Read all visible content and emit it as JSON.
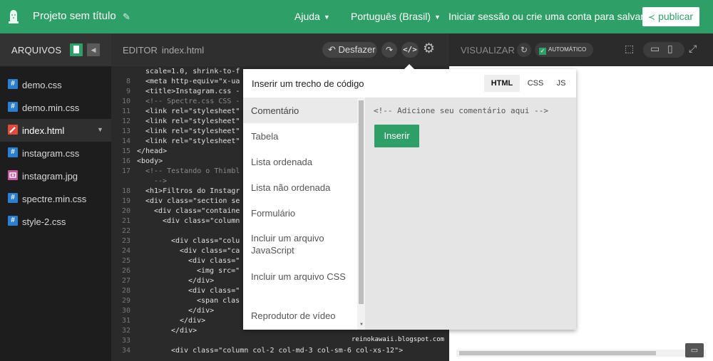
{
  "topbar": {
    "title": "Projeto sem título",
    "help": "Ajuda",
    "language": "Português (Brasil)",
    "login": "Iniciar sessão ou crie uma conta para salvar e",
    "publish": "publicar"
  },
  "sidebar": {
    "header": "ARQUIVOS",
    "files": [
      {
        "name": "demo.css",
        "icon": "#",
        "color": "#2a7fd1"
      },
      {
        "name": "demo.min.css",
        "icon": "#",
        "color": "#2a7fd1"
      },
      {
        "name": "index.html",
        "icon": "",
        "color": "#e04a3d"
      },
      {
        "name": "instagram.css",
        "icon": "#",
        "color": "#2a7fd1"
      },
      {
        "name": "instagram.jpg",
        "icon": "",
        "color": "#c15a9c"
      },
      {
        "name": "spectre.min.css",
        "icon": "#",
        "color": "#2a7fd1"
      },
      {
        "name": "style-2.css",
        "icon": "#",
        "color": "#2a7fd1"
      }
    ]
  },
  "editor": {
    "label": "EDITOR",
    "filename": "index.html",
    "undo": "Desfazer",
    "lines": [
      {
        "n": "",
        "t": "scale=1.0, shrink-to-f"
      },
      {
        "n": "8",
        "t": "<meta http-equiv=\"x-ua"
      },
      {
        "n": "9",
        "t": "<title>Instagram.css -"
      },
      {
        "n": "10",
        "t": "<!-- Spectre.css CSS -"
      },
      {
        "n": "11",
        "t": "<link rel=\"stylesheet\""
      },
      {
        "n": "12",
        "t": "<link rel=\"stylesheet\""
      },
      {
        "n": "13",
        "t": "<link rel=\"stylesheet\""
      },
      {
        "n": "14",
        "t": "<link rel=\"stylesheet\""
      },
      {
        "n": "15",
        "t": "</head>"
      },
      {
        "n": "16",
        "t": "<body>"
      },
      {
        "n": "17",
        "t": "<!-- Testando o Thimbl"
      },
      {
        "n": "",
        "t": "-->"
      },
      {
        "n": "18",
        "t": "<h1>Filtros do Instagr"
      },
      {
        "n": "19",
        "t": "<div class=\"section se"
      },
      {
        "n": "20",
        "t": "<div class=\"containe"
      },
      {
        "n": "21",
        "t": "<div class=\"column"
      },
      {
        "n": "22",
        "t": ""
      },
      {
        "n": "23",
        "t": "<div class=\"colu"
      },
      {
        "n": "24",
        "t": "<div class=\"ca"
      },
      {
        "n": "25",
        "t": "<div class=\""
      },
      {
        "n": "26",
        "t": "<img src=\""
      },
      {
        "n": "27",
        "t": "</div>"
      },
      {
        "n": "28",
        "t": "<div class=\""
      },
      {
        "n": "29",
        "t": "<span clas"
      },
      {
        "n": "30",
        "t": "</div>"
      },
      {
        "n": "31",
        "t": "</div>"
      },
      {
        "n": "32",
        "t": "</div>"
      },
      {
        "n": "33",
        "t": ""
      },
      {
        "n": "34",
        "t": "<div class=\"column col-2 col-md-3 col-sm-6 col-xs-12\">"
      }
    ]
  },
  "preview": {
    "label": "VISUALIZAR",
    "auto": "AUTOMÁTICO"
  },
  "popover": {
    "title": "Inserir um trecho de código",
    "tabs": [
      "HTML",
      "CSS",
      "JS"
    ],
    "items": [
      "Comentário",
      "Tabela",
      "Lista ordenada",
      "Lista não ordenada",
      "Formulário",
      "Incluir um arquivo JavaScript",
      "Incluir um arquivo CSS",
      "Reprodutor de vídeo"
    ],
    "code": "<!-- Adicione seu comentário aqui -->",
    "insert": "Inserir"
  },
  "watermark": "reinokawaii.blogspot.com"
}
